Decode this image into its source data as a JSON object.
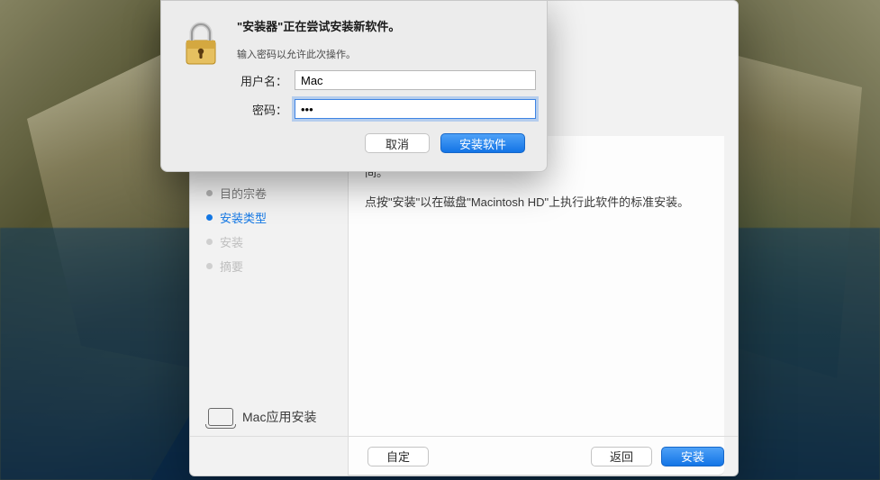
{
  "installer": {
    "sidebar_items": [
      {
        "label": "目的宗卷",
        "state": "done"
      },
      {
        "label": "安装类型",
        "state": "current"
      },
      {
        "label": "安装",
        "state": "pending"
      },
      {
        "label": "摘要",
        "state": "pending"
      }
    ],
    "main_text_partial_disk": "间。",
    "main_text_instruction": "点按\"安装\"以在磁盘\"Macintosh HD\"上执行此软件的标准安装。",
    "logo_label": "Mac应用安装",
    "buttons": {
      "customize": "自定",
      "back": "返回",
      "install": "安装"
    }
  },
  "auth": {
    "title": "\"安装器\"正在尝试安装新软件。",
    "subtitle": "输入密码以允许此次操作。",
    "username_label": "用户名：",
    "username_value": "Mac",
    "password_label": "密码：",
    "password_value": "•••",
    "buttons": {
      "cancel": "取消",
      "install": "安装软件"
    }
  }
}
